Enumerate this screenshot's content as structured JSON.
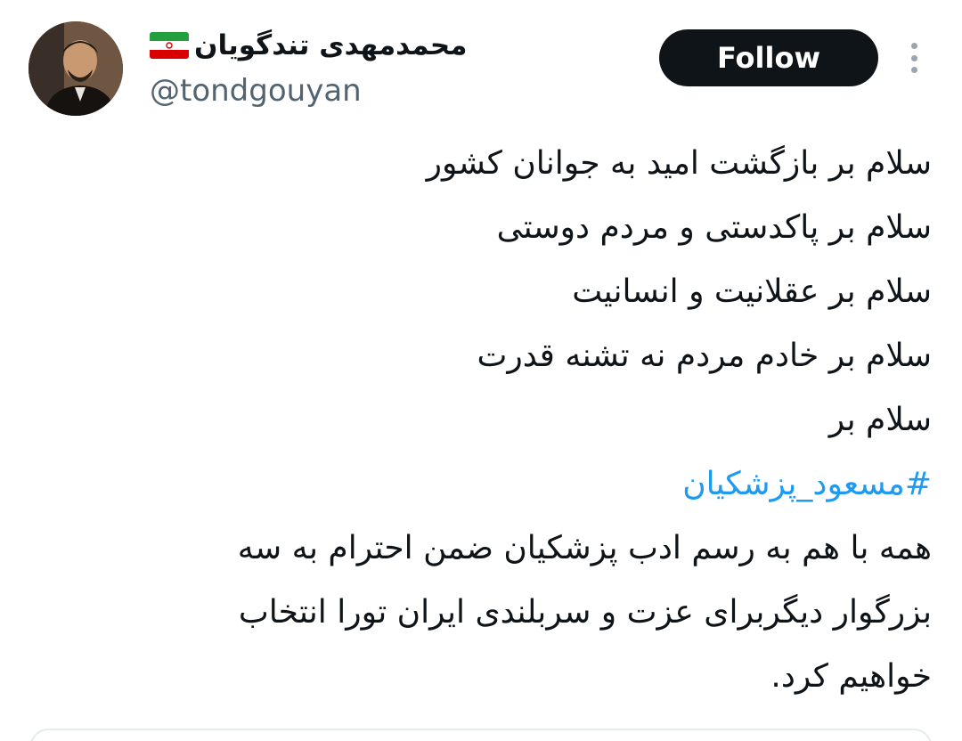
{
  "author": {
    "display_name": "محمدمهدی تندگویان",
    "handle": "@tondgouyan",
    "flag_icon": "iran-flag-icon"
  },
  "actions": {
    "follow_label": "Follow",
    "more_icon": "more-vertical-icon"
  },
  "tweet": {
    "lines": [
      "سلام بر بازگشت امید به جوانان کشور",
      "سلام بر پاکدستی و مردم دوستی",
      "سلام بر عقلانیت و انسانیت",
      "سلام بر خادم مردم نه تشنه قدرت",
      "سلام بر",
      "#مسعود_پزشکیان",
      "همه با هم به رسم ادب پزشکیان ضمن احترام به سه",
      "بزرگوار دیگربرای عزت و سربلندی ایران تورا انتخاب",
      "خواهیم کرد."
    ]
  },
  "colors": {
    "follow_bg": "#0f1419",
    "hashtag": "#1d9bf0",
    "handle": "#536471"
  }
}
